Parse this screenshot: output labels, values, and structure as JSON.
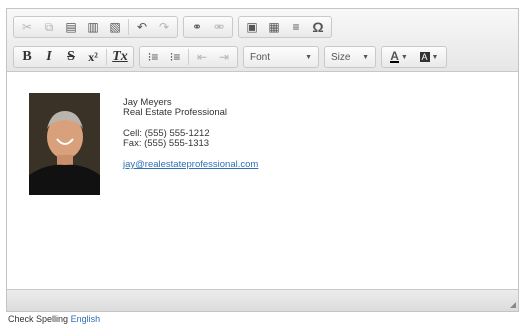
{
  "toolbar": {
    "row1": [
      "✂",
      "⧉",
      "📋",
      "📋",
      "📋",
      "↶",
      "↷",
      "🔗",
      "⛓",
      "🖼",
      "▦",
      "≡",
      "Ω"
    ],
    "font_label": "Font",
    "size_label": "Size",
    "format_icons": {
      "bold": "B",
      "italic": "I",
      "strike": "S",
      "superscript": "x²",
      "remove_format": "Tx",
      "ordered_list": "⋮≡",
      "bullet_list": "⋮≡",
      "outdent": "⇤",
      "indent": "⇥",
      "text_color": "A",
      "bg_color": "◩"
    }
  },
  "signature": {
    "name": "Jay Meyers",
    "title": "Real Estate Professional",
    "cell": "Cell: (555) 555-1212",
    "fax": "Fax: (555) 555-1313",
    "email": "jay@realestateprofessional.com"
  },
  "spellcheck": {
    "label": "Check Spelling",
    "language": "English"
  }
}
